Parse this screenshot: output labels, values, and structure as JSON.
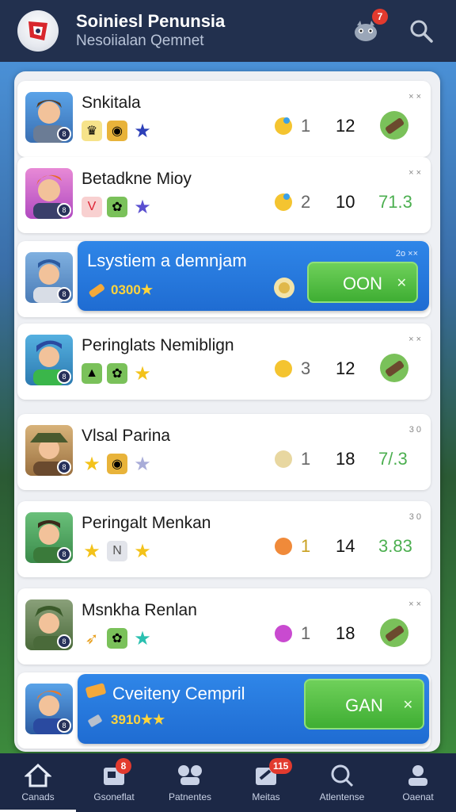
{
  "header": {
    "title": "Soiniesl Penunsia",
    "subtitle": "Nesoiialan Qemnet",
    "notif_badge": "7"
  },
  "rows": [
    {
      "name": "Snkitala",
      "a": "1",
      "b": "12",
      "c": "",
      "corner": "× ×"
    },
    {
      "name": "Betadkne Mioy",
      "a": "2",
      "b": "10",
      "c": "71.3",
      "corner": "× ×"
    },
    {
      "name": "Peringlats Nemiblign",
      "a": "3",
      "b": "12",
      "c": "",
      "corner": "× ×"
    },
    {
      "name": "Vlsal Parina",
      "a": "1",
      "b": "18",
      "c": "7/.3",
      "corner": "3 0"
    },
    {
      "name": "Peringalt Menkan",
      "a": "1",
      "b": "14",
      "c": "3.83",
      "corner": "3 0"
    },
    {
      "name": "Msnkha Renlan",
      "a": "1",
      "b": "18",
      "c": "",
      "corner": "× ×"
    }
  ],
  "featured": [
    {
      "title": "Lsystiem a demnjam",
      "score": "0300★",
      "button": "OON",
      "corner": "2o ××"
    },
    {
      "title": "Cveiteny Cempril",
      "score": "3910★★",
      "button": "GAN"
    }
  ],
  "nav": [
    {
      "label": "Canads",
      "badge": ""
    },
    {
      "label": "Gsoneflat",
      "badge": "8"
    },
    {
      "label": "Patnentes",
      "badge": ""
    },
    {
      "label": "Meitas",
      "badge": "115"
    },
    {
      "label": "Atlentense",
      "badge": ""
    },
    {
      "label": "Oaenat",
      "badge": ""
    }
  ]
}
